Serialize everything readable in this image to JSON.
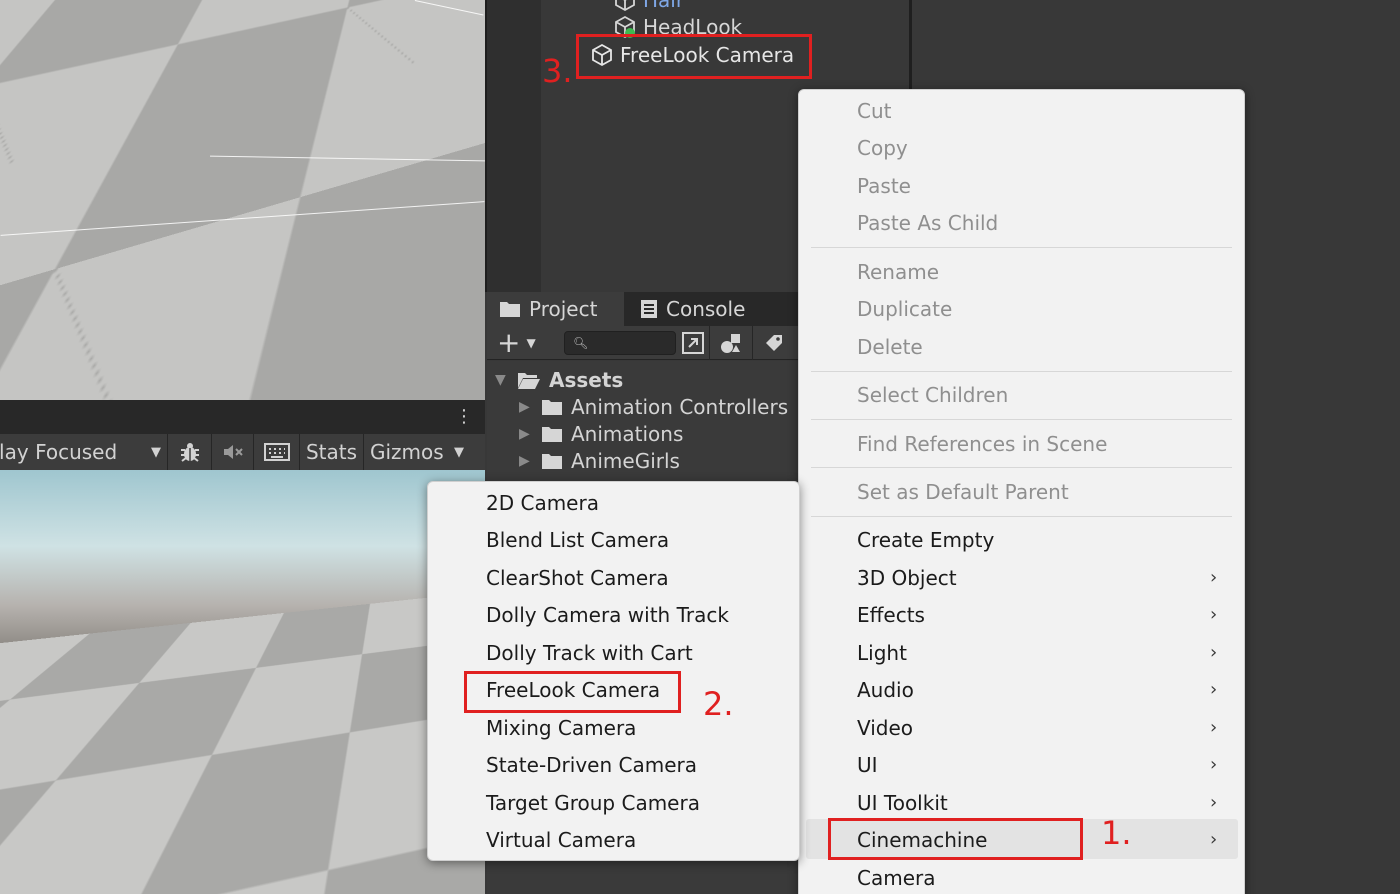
{
  "hierarchy": {
    "items": [
      {
        "label": "Hair",
        "icon": "cube-icon"
      },
      {
        "label": "HeadLook",
        "icon": "cube-icon"
      },
      {
        "label": "FreeLook Camera",
        "icon": "cube-icon"
      }
    ]
  },
  "game_view": {
    "play_mode": "Play Focused",
    "stats_label": "Stats",
    "gizmos_label": "Gizmos"
  },
  "project": {
    "tabs": [
      {
        "label": "Project",
        "icon": "folder-icon",
        "active": true
      },
      {
        "label": "Console",
        "icon": "console-icon",
        "active": false
      }
    ],
    "root_folder": "Assets",
    "folders": [
      "Animation Controllers",
      "Animations",
      "AnimeGirls"
    ]
  },
  "context_menu": {
    "groups": [
      [
        "Cut",
        "Copy",
        "Paste",
        "Paste As Child"
      ],
      [
        "Rename",
        "Duplicate",
        "Delete"
      ],
      [
        "Select Children"
      ],
      [
        "Find References in Scene"
      ],
      [
        "Set as Default Parent"
      ]
    ],
    "create_items": [
      {
        "label": "Create Empty",
        "submenu": false
      },
      {
        "label": "3D Object",
        "submenu": true
      },
      {
        "label": "Effects",
        "submenu": true
      },
      {
        "label": "Light",
        "submenu": true
      },
      {
        "label": "Audio",
        "submenu": true
      },
      {
        "label": "Video",
        "submenu": true
      },
      {
        "label": "UI",
        "submenu": true
      },
      {
        "label": "UI Toolkit",
        "submenu": true
      },
      {
        "label": "Cinemachine",
        "submenu": true,
        "highlighted": true
      },
      {
        "label": "Camera",
        "submenu": false
      }
    ]
  },
  "cinemachine_submenu": {
    "items": [
      "2D Camera",
      "Blend List Camera",
      "ClearShot Camera",
      "Dolly Camera with Track",
      "Dolly Track with Cart",
      "FreeLook Camera",
      "Mixing Camera",
      "State-Driven Camera",
      "Target Group Camera",
      "Virtual Camera"
    ]
  },
  "annotations": {
    "step1": "1.",
    "step2": "2.",
    "step3": "3.",
    "color": "#e02020"
  },
  "colors": {
    "hair_label": "#7fa7e6",
    "menu_bg": "#f2f2f2",
    "disabled_text": "#8f8f8f"
  }
}
